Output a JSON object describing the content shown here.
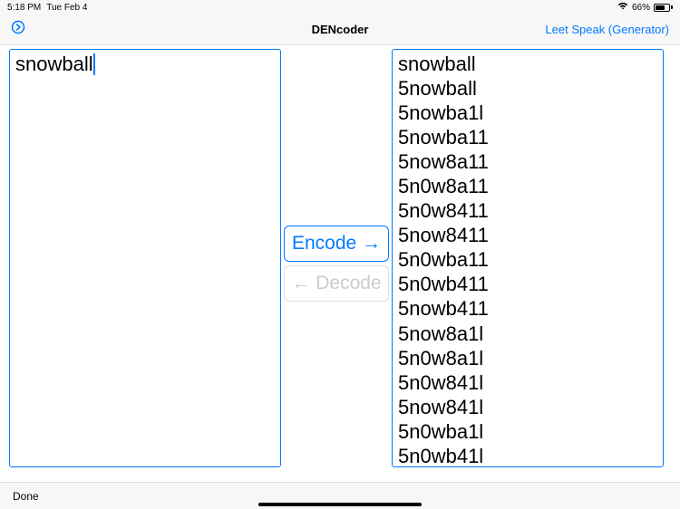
{
  "status": {
    "time": "5:18 PM",
    "date": "Tue Feb 4",
    "battery_pct": "66%"
  },
  "nav": {
    "title": "DENcoder",
    "right_link": "Leet Speak (Generator)"
  },
  "input": {
    "text": "snowball"
  },
  "buttons": {
    "encode": "Encode →",
    "decode": "← Decode"
  },
  "output": {
    "lines": [
      "snowball",
      "5nowball",
      "5nowba1l",
      "5nowba11",
      "5now8a11",
      "5n0w8a11",
      "5n0w8411",
      "5now8411",
      "5n0wba11",
      "5n0wb411",
      "5nowb411",
      "5now8a1l",
      "5n0w8a1l",
      "5n0w841l",
      "5now841l",
      "5n0wba1l",
      "5n0wb41l"
    ]
  },
  "bottom": {
    "done": "Done"
  }
}
